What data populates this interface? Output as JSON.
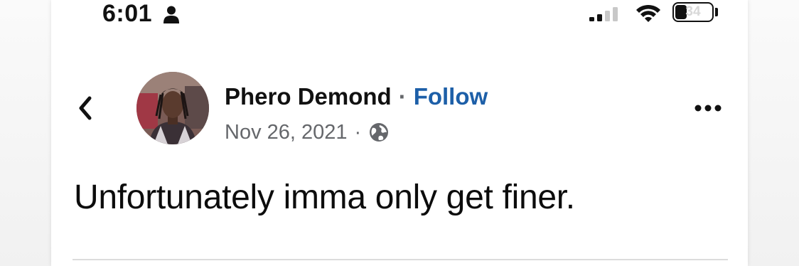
{
  "status_bar": {
    "time": "6:01",
    "battery_level": "34",
    "icons": [
      "person-icon",
      "signal-icon",
      "wifi-icon",
      "battery-icon"
    ]
  },
  "post": {
    "author": "Phero Demond",
    "separator": "·",
    "follow_label": "Follow",
    "date": "Nov 26, 2021",
    "date_separator": "·",
    "privacy_icon": "globe-icon",
    "text": "Unfortunately imma only get finer."
  },
  "header": {
    "back_icon": "chevron-left-icon",
    "more_icon": "more-horizontal-icon"
  },
  "colors": {
    "link": "#1d5fa8",
    "meta": "#65676b",
    "text": "#111111"
  }
}
